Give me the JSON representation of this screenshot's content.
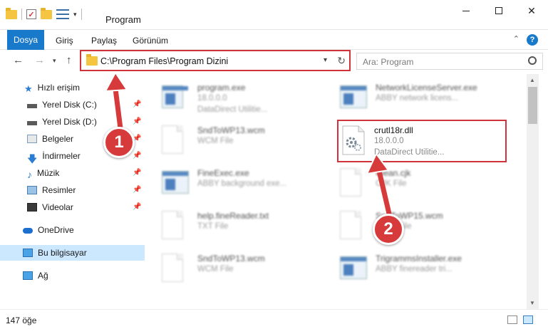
{
  "window": {
    "title": "Program",
    "quick_access_dropdown": "▾"
  },
  "ribbon": {
    "tabs": [
      "Dosya",
      "Giriş",
      "Paylaş",
      "Görünüm"
    ],
    "help": "?"
  },
  "address": {
    "path": "C:\\Program Files\\Program Dizini",
    "search_placeholder": "Ara: Program"
  },
  "sidebar": {
    "items": [
      {
        "label": "Hızlı erişim",
        "icon": "star-icon",
        "color": "#2b7cd3"
      },
      {
        "label": "Yerel Disk (C:)",
        "icon": "drive-icon",
        "pinned": true
      },
      {
        "label": "Yerel Disk (D:)",
        "icon": "drive-icon",
        "pinned": true
      },
      {
        "label": "Belgeler",
        "icon": "documents-icon",
        "pinned": true
      },
      {
        "label": "İndirmeler",
        "icon": "download-icon",
        "pinned": true
      },
      {
        "label": "Müzik",
        "icon": "music-icon",
        "pinned": true
      },
      {
        "label": "Resimler",
        "icon": "pictures-icon",
        "pinned": true
      },
      {
        "label": "Videolar",
        "icon": "videos-icon",
        "pinned": true
      },
      {
        "label": "OneDrive",
        "icon": "cloud-icon"
      },
      {
        "label": "Bu bilgisayar",
        "icon": "computer-icon",
        "selected": true
      },
      {
        "label": "Ağ",
        "icon": "network-icon"
      }
    ]
  },
  "files": [
    {
      "name": "program.exe",
      "line1": "18.0.0.0",
      "line2": "DataDirect Utilitie...",
      "icon": "exe-icon"
    },
    {
      "name": "NetworkLicenseServer.exe",
      "line1": "ABBY network licens...",
      "line2": "",
      "icon": "app-window-icon"
    },
    {
      "name": "SndToWP13.wcm",
      "line1": "WCM File",
      "line2": "",
      "icon": "document-icon"
    },
    {
      "name": "crutl18r.dll",
      "line1": "18.0.0.0",
      "line2": "DataDirect Utilitie...",
      "icon": "dll-gear-icon"
    },
    {
      "name": "FineExec.exe",
      "line1": "ABBY background exe...",
      "line2": "",
      "icon": "app-window-icon"
    },
    {
      "name": "Clean.cjk",
      "line1": "CJK File",
      "line2": "",
      "icon": "document-icon"
    },
    {
      "name": "help.fineReader.txt",
      "line1": "TXT File",
      "line2": "",
      "icon": "document-icon"
    },
    {
      "name": "SndToWP15.wcm",
      "line1": "WCM File",
      "line2": "",
      "icon": "document-icon"
    },
    {
      "name": "SndToWP13.wcm",
      "line1": "WCM File",
      "line2": "",
      "icon": "document-icon"
    },
    {
      "name": "TrigrammsInstaller.exe",
      "line1": "ABBY finereader tri...",
      "line2": "",
      "icon": "app-window-icon"
    }
  ],
  "callouts": {
    "one": "1",
    "two": "2",
    "color": "#d73a3a"
  },
  "status": {
    "count": "147 öğe"
  }
}
